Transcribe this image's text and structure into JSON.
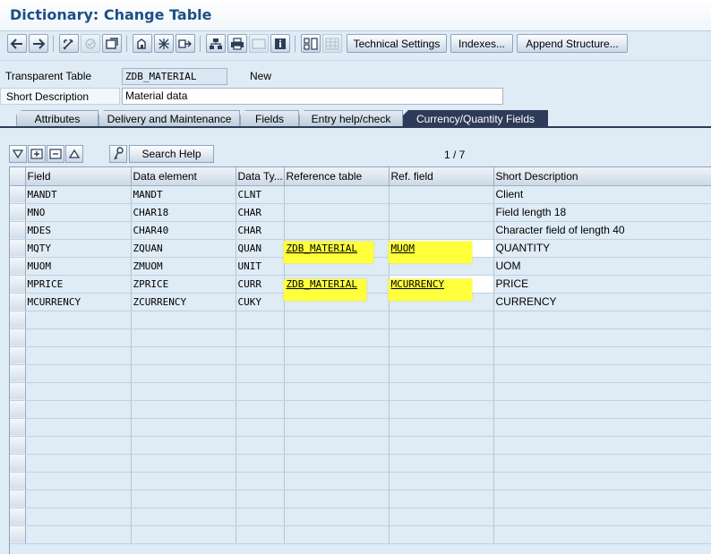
{
  "title": "Dictionary: Change Table",
  "toolbar": {
    "technical_settings": "Technical Settings",
    "indexes": "Indexes...",
    "append_structure": "Append Structure..."
  },
  "header": {
    "table_type_label": "Transparent Table",
    "table_name": "ZDB_MATERIAL",
    "status": "New",
    "short_desc_label": "Short Description",
    "short_desc_value": "Material data"
  },
  "tabs": [
    {
      "label": "Attributes"
    },
    {
      "label": "Delivery and Maintenance"
    },
    {
      "label": "Fields"
    },
    {
      "label": "Entry help/check"
    },
    {
      "label": "Currency/Quantity Fields",
      "active": true
    }
  ],
  "panel": {
    "search_help": "Search Help",
    "page_indicator": "1 / 7"
  },
  "grid": {
    "columns": [
      "Field",
      "Data element",
      "Data Ty...",
      "Reference table",
      "Ref. field",
      "Short Description"
    ],
    "rows": [
      {
        "field": "MANDT",
        "element": "MANDT",
        "type": "CLNT",
        "ref_table": "",
        "ref_field": "",
        "desc": "Client"
      },
      {
        "field": "MNO",
        "element": "CHAR18",
        "type": "CHAR",
        "ref_table": "",
        "ref_field": "",
        "desc": "Field length 18"
      },
      {
        "field": "MDES",
        "element": "CHAR40",
        "type": "CHAR",
        "ref_table": "",
        "ref_field": "",
        "desc": "Character field of length 40"
      },
      {
        "field": "MQTY",
        "element": "ZQUAN",
        "type": "QUAN",
        "ref_table": "ZDB_MATERIAL",
        "ref_field": "MUOM",
        "desc": "QUANTITY"
      },
      {
        "field": "MUOM",
        "element": "ZMUOM",
        "type": "UNIT",
        "ref_table": "",
        "ref_field": "",
        "desc": "UOM"
      },
      {
        "field": "MPRICE",
        "element": "ZPRICE",
        "type": "CURR",
        "ref_table": "ZDB_MATERIAL",
        "ref_field": "MCURRENCY",
        "desc": "PRICE"
      },
      {
        "field": "MCURRENCY",
        "element": "ZCURRENCY",
        "type": "CUKY",
        "ref_table": "",
        "ref_field": "",
        "desc": "CURRENCY"
      }
    ],
    "empty_rows": 13
  },
  "colors": {
    "background": "#dfebf5",
    "title": "#1c4f86",
    "active_tab": "#2e3b58",
    "highlight": "#ffff3c"
  },
  "icons": [
    "back-icon",
    "forward-icon",
    "display-change-icon",
    "activate-icon",
    "check-icon",
    "other-object-icon",
    "where-used-icon",
    "navigate-icon",
    "hierarchy-icon",
    "print-icon",
    "info-icon",
    "layout-icon",
    "grid-icon",
    "filter-icon",
    "insert-row-icon",
    "delete-row-icon",
    "sort-icon",
    "key-icon"
  ]
}
